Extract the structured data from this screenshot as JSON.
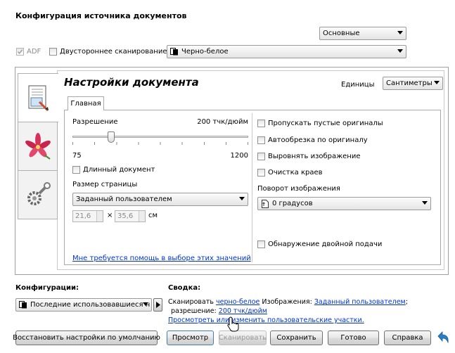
{
  "header": {
    "title": "Конфигурация источника документов",
    "mode_select": "Основные"
  },
  "source": {
    "adf_label": "ADF",
    "duplex_label": "Двустороннее сканирование",
    "color_select": "Черно-белое"
  },
  "panel": {
    "title": "Настройки документа",
    "units_label": "Единицы",
    "units_value": "Сантиметры",
    "tab_main": "Главная",
    "resolution_label": "Разрешение",
    "resolution_value": "200 тчк/дюйм",
    "resolution_min": "75",
    "resolution_max": "1200",
    "resolution_fraction": 0.21,
    "long_doc_label": "Длинный документ",
    "page_size_label": "Размер страницы",
    "page_size_value": "Заданный пользователем",
    "width_value": "21,6",
    "height_value": "35,6",
    "times_sign": "×",
    "unit_short": "см",
    "help_link": "Мне требуется помощь в выборе этих значений",
    "options": [
      "Пропускать пустые оригиналы",
      "Автообрезка по оригиналу",
      "Выровнять изображение",
      "Очистка краев"
    ],
    "rotation_label": "Поворот изображения",
    "rotation_value": "0 градусов",
    "double_feed_label": "Обнаружение двойной подачи"
  },
  "config": {
    "label": "Конфигурации:",
    "select": "Последние использовавшиеся н"
  },
  "summary": {
    "label": "Сводка:",
    "scan_prefix": "Сканировать",
    "scan_mode": "черно-белое",
    "images_label": "Изображения:",
    "images_value": "Заданный пользователем",
    "semicolon": ";",
    "resolution_prefix": "разрешение:",
    "resolution_value": "200 тчк/дюйм",
    "preview_link": "Просмотреть или изменить пользовательские участки."
  },
  "buttons": {
    "restore": "Восстановить настройки по умолчанию",
    "preview": "Просмотр",
    "scan": "Сканировать",
    "save": "Сохранить",
    "done": "Готово",
    "help": "Справка"
  },
  "colors": {
    "accent_link": "#0033cc",
    "panel_border": "#a0a0a0",
    "undo_arrow": "#2a7fc0",
    "lily_petal": "#d8305a"
  }
}
